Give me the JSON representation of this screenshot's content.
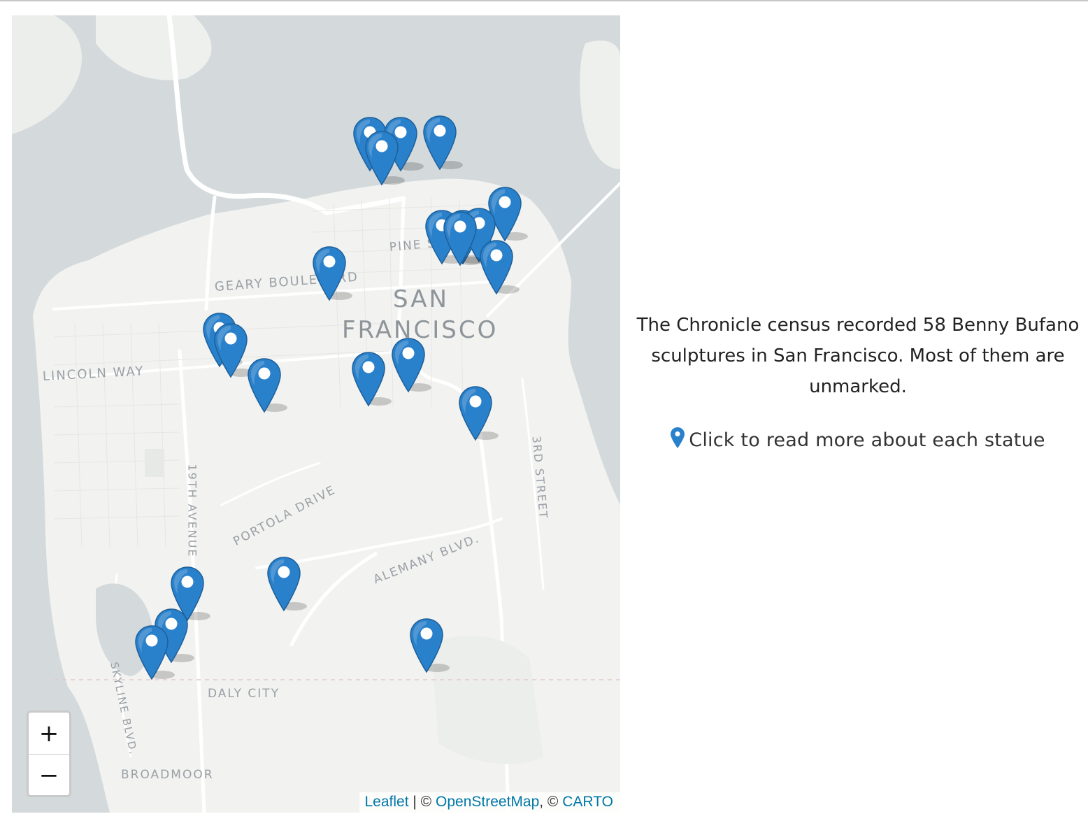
{
  "map": {
    "labels": {
      "city_line1": "SAN",
      "city_line2": "FRANCISCO",
      "pine": "PINE ST",
      "geary": "GEARY BOULEVARD",
      "lincoln": "LINCOLN WAY",
      "portola": "PORTOLA DRIVE",
      "nineteenth": "19TH AVENUE",
      "alemany": "ALEMANY BLVD.",
      "third": "3RD STREET",
      "skyline": "SKYLINE BLVD.",
      "daly_city": "DALY CITY",
      "broadmoor": "BROADMOOR"
    },
    "marker_icon": "map-pin-icon",
    "marker_count": 23,
    "colors": {
      "water": "#d4dadc",
      "land": "#f2f2f0",
      "marker": "#2a81cb"
    },
    "zoom": {
      "in_label": "+",
      "out_label": "−"
    },
    "attribution": {
      "leaflet": "Leaflet",
      "sep1": " | © ",
      "osm": "OpenStreetMap",
      "sep2": ", © ",
      "carto": "CARTO"
    }
  },
  "side": {
    "census_text": "The Chronicle census recorded 58 Benny Bufano sculptures in San Francisco. Most of them are unmarked.",
    "hint_icon": "map-pin-icon",
    "hint_text": "Click to read more about each statue"
  }
}
